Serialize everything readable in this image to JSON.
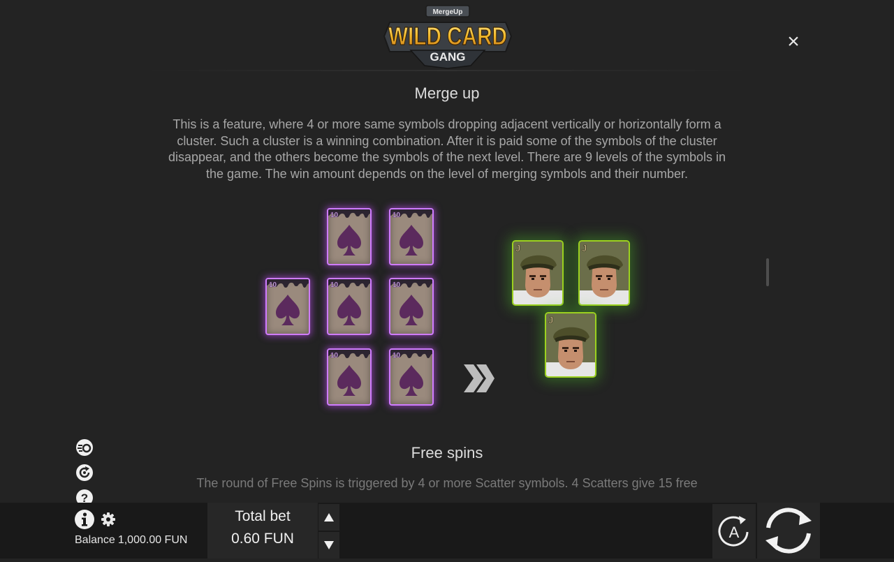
{
  "logo": {
    "top_text": "MergeUp",
    "main_text": "WILD CARD",
    "sub_text": "GANG"
  },
  "close_label": "×",
  "sections": [
    {
      "title": "Merge up",
      "text": "This is a feature, where 4 or more same symbols dropping adjacent vertically or horizontally form a cluster. Such a cluster is a winning combination. After it is paid some of the symbols of the cluster disappear, and the others become the symbols of the next level. There are 9 levels of the symbols in the game. The win amount depends on the level of merging symbols and their number."
    },
    {
      "title": "Free spins",
      "text": "The round of Free Spins is triggered by 4 or more Scatter symbols. 4 Scatters give 15 free"
    }
  ],
  "example": {
    "source_symbol_label": "10",
    "result_symbol_label": "J",
    "source_count": 7,
    "result_count": 3
  },
  "bottom_bar": {
    "balance_label": "Balance",
    "balance_value": "1,000.00 FUN",
    "bet_label": "Total bet",
    "bet_value": "0.60 FUN",
    "auto_label": "A"
  },
  "colors": {
    "background": "#232323",
    "card_glow": "#cf7cff",
    "jcard_glow": "#9cd11f",
    "logo_gold": "#f1c232"
  },
  "icons": [
    "turbo-icon",
    "history-icon",
    "help-icon",
    "info-icon",
    "gear-icon",
    "arrow-up-icon",
    "arrow-down-icon",
    "autoplay-icon",
    "spin-icon",
    "close-icon",
    "double-chevron-right-icon"
  ]
}
